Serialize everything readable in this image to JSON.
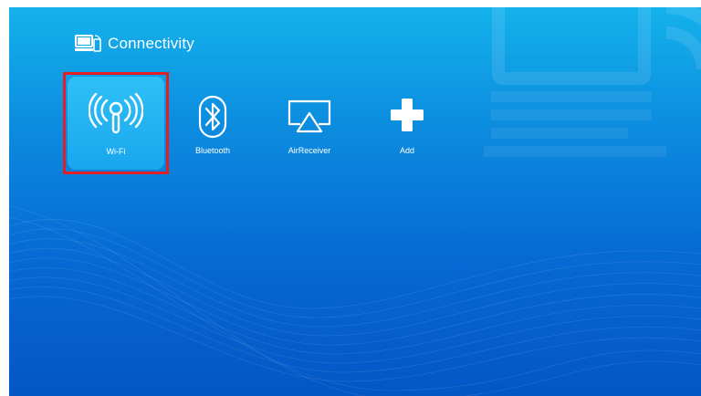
{
  "header": {
    "icon": "monitor-phone-icon",
    "title": "Connectivity"
  },
  "tiles": [
    {
      "id": "wifi",
      "label": "Wi-Fi",
      "icon": "wifi-antenna-icon",
      "selected": true
    },
    {
      "id": "bluetooth",
      "label": "Bluetooth",
      "icon": "bluetooth-icon",
      "selected": false
    },
    {
      "id": "airreceiver",
      "label": "AirReceiver",
      "icon": "airplay-icon",
      "selected": false
    },
    {
      "id": "add",
      "label": "Add",
      "icon": "plus-icon",
      "selected": false
    }
  ],
  "colors": {
    "background_top": "#14b2ec",
    "background_bottom": "#0456c5",
    "selected_tile": "#22b2f2",
    "highlight_border": "#e01f26"
  }
}
